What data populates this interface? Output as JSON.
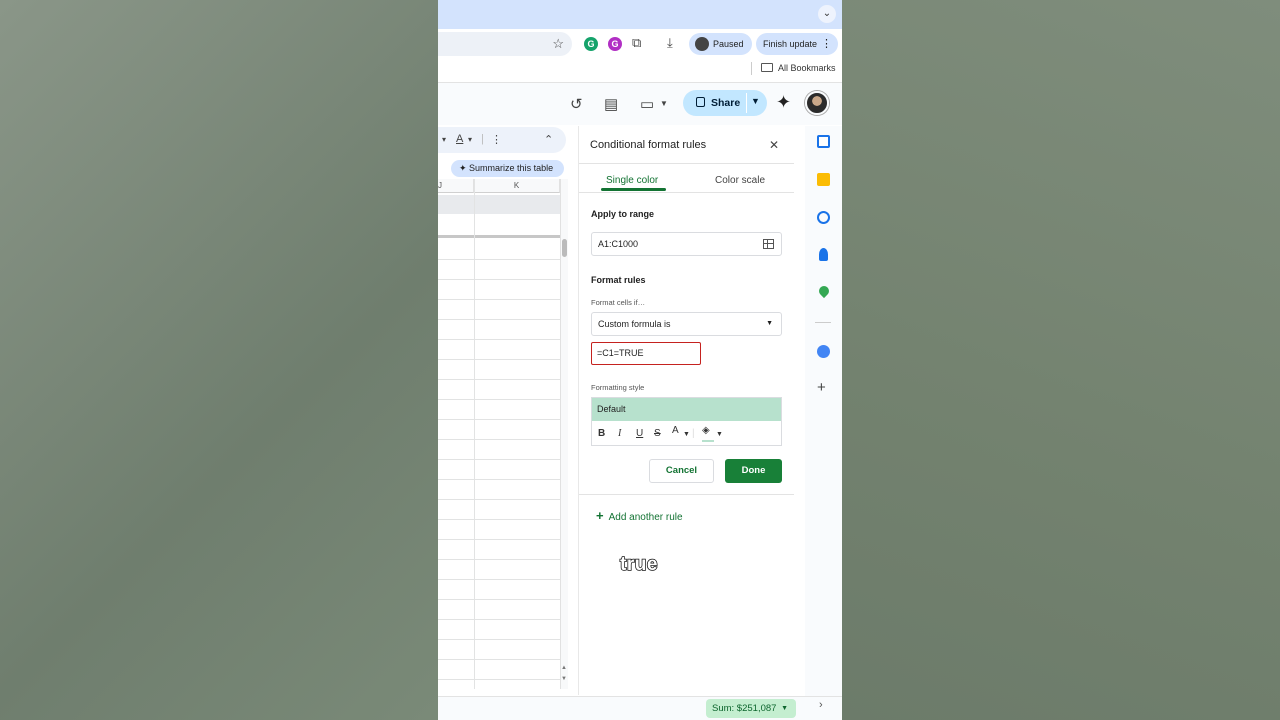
{
  "browser": {
    "paused_label": "Paused",
    "finish_update_label": "Finish update",
    "bookmarks_label": "All Bookmarks"
  },
  "sheets": {
    "share_label": "Share",
    "summarize_label": "Summarize this table",
    "columns": [
      "J",
      "K"
    ],
    "sum_label": "Sum: $251,087"
  },
  "panel": {
    "title": "Conditional format rules",
    "tabs": [
      "Single color",
      "Color scale"
    ],
    "apply_to_range_label": "Apply to range",
    "range_value": "A1:C1000",
    "format_rules_label": "Format rules",
    "format_cells_if_label": "Format cells if…",
    "condition_value": "Custom formula is",
    "formula_value": "=C1=TRUE",
    "formatting_style_label": "Formatting style",
    "style_preview_label": "Default",
    "style_tools": [
      "B",
      "I",
      "U",
      "S",
      "A"
    ],
    "cancel_label": "Cancel",
    "done_label": "Done",
    "add_rule_label": "Add another rule",
    "fill_color": "#b7e1cd"
  },
  "caption": "true",
  "colors": {
    "accent_green": "#137333",
    "done_button": "#188038",
    "formula_border": "#c5221f",
    "share_button": "#c2e7ff",
    "tabstrip": "#d3e3fd"
  }
}
